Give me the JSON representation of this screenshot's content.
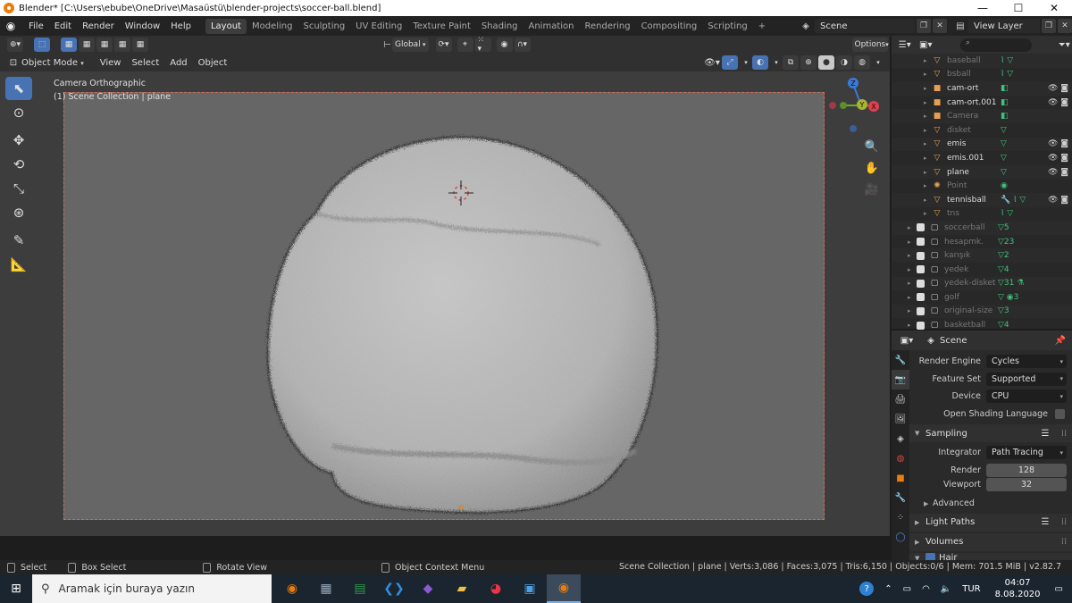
{
  "window": {
    "title": "Blender* [C:\\Users\\ebube\\OneDrive\\Masaüstü\\blender-projects\\soccer-ball.blend]",
    "min": "—",
    "max": "☐",
    "close": "✕"
  },
  "menus": [
    "File",
    "Edit",
    "Render",
    "Window",
    "Help"
  ],
  "workspaces": [
    {
      "label": "Layout",
      "active": true
    },
    {
      "label": "Modeling"
    },
    {
      "label": "Sculpting"
    },
    {
      "label": "UV Editing"
    },
    {
      "label": "Texture Paint"
    },
    {
      "label": "Shading"
    },
    {
      "label": "Animation"
    },
    {
      "label": "Rendering"
    },
    {
      "label": "Compositing"
    },
    {
      "label": "Scripting"
    }
  ],
  "add_workspace": "+",
  "scene": {
    "name": "Scene"
  },
  "view_layer": {
    "name": "View Layer"
  },
  "tool_header": {
    "orientation": "Global",
    "options": "Options"
  },
  "viewport_header": {
    "mode": "Object Mode",
    "menus": [
      "View",
      "Select",
      "Add",
      "Object"
    ]
  },
  "viewport": {
    "view_name": "Camera Orthographic",
    "collection_info": "(1) Scene Collection | plane",
    "gizmo": {
      "z": "Z",
      "y": "Y",
      "x": "X"
    }
  },
  "outliner": {
    "rows": [
      {
        "name": "baseball",
        "dim": true,
        "indent": 1,
        "icon": "▽",
        "mods": "⌇ ▽"
      },
      {
        "name": "bsball",
        "dim": true,
        "indent": 1,
        "icon": "▽",
        "mods": "⌇ ▽"
      },
      {
        "name": "cam-ort",
        "dim": false,
        "indent": 1,
        "icon": "■",
        "mods": "◧",
        "vis": "👁 ◙"
      },
      {
        "name": "cam-ort.001",
        "dim": false,
        "indent": 1,
        "icon": "■",
        "mods": "◧",
        "vis": "👁 ◙"
      },
      {
        "name": "Camera",
        "dim": true,
        "indent": 1,
        "icon": "■",
        "mods": "◧"
      },
      {
        "name": "disket",
        "dim": true,
        "indent": 1,
        "icon": "▽",
        "mods": "▽"
      },
      {
        "name": "emis",
        "dim": false,
        "indent": 1,
        "icon": "▽",
        "mods": "▽",
        "vis": "👁 ◙"
      },
      {
        "name": "emis.001",
        "dim": false,
        "indent": 1,
        "icon": "▽",
        "mods": "▽",
        "vis": "👁 ◙"
      },
      {
        "name": "plane",
        "dim": false,
        "indent": 1,
        "icon": "▽",
        "mods": "▽",
        "vis": "👁 ◙"
      },
      {
        "name": "Point",
        "dim": true,
        "indent": 1,
        "icon": "✺",
        "mods": "◉"
      },
      {
        "name": "tennisball",
        "dim": false,
        "indent": 1,
        "icon": "▽",
        "mods": "🔧 ⌇ ▽",
        "vis": "👁 ◙"
      },
      {
        "name": "tns",
        "dim": true,
        "indent": 1,
        "icon": "▽",
        "mods": "⌇ ▽"
      },
      {
        "name": "soccerball",
        "dim": true,
        "indent": 0,
        "icon": "▢",
        "mods": "▽5",
        "check": true
      },
      {
        "name": "hesapmk.",
        "dim": true,
        "indent": 0,
        "icon": "▢",
        "mods": "▽23",
        "check": true
      },
      {
        "name": "karışık",
        "dim": true,
        "indent": 0,
        "icon": "▢",
        "mods": "▽2",
        "check": true
      },
      {
        "name": "yedek",
        "dim": true,
        "indent": 0,
        "icon": "▢",
        "mods": "▽4",
        "check": true
      },
      {
        "name": "yedek-disket",
        "dim": true,
        "indent": 0,
        "icon": "▢",
        "mods": "▽31 ⚗",
        "check": true
      },
      {
        "name": "golf",
        "dim": true,
        "indent": 0,
        "icon": "▢",
        "mods": "▽ ◉3",
        "check": true
      },
      {
        "name": "original-size",
        "dim": true,
        "indent": 0,
        "icon": "▢",
        "mods": "▽3",
        "check": true
      },
      {
        "name": "basketball",
        "dim": true,
        "indent": 0,
        "icon": "▢",
        "mods": "▽4",
        "check": true
      }
    ]
  },
  "properties": {
    "header": "Scene",
    "render_engine": {
      "label": "Render Engine",
      "value": "Cycles"
    },
    "feature_set": {
      "label": "Feature Set",
      "value": "Supported"
    },
    "device": {
      "label": "Device",
      "value": "CPU"
    },
    "osl": {
      "label": "Open Shading Language"
    },
    "sampling": {
      "title": "Sampling",
      "integrator": {
        "label": "Integrator",
        "value": "Path Tracing"
      },
      "render": {
        "label": "Render",
        "value": "128"
      },
      "viewport": {
        "label": "Viewport",
        "value": "32"
      },
      "advanced": "Advanced"
    },
    "light_paths": "Light Paths",
    "volumes": "Volumes",
    "hair": "Hair"
  },
  "statusbar": {
    "select": "Select",
    "box_select": "Box Select",
    "rotate_view": "Rotate View",
    "context_menu": "Object Context Menu",
    "stats": "Scene Collection | plane | Verts:3,086 | Faces:3,075 | Tris:6,150 | Objects:0/6 | Mem: 701.5 MiB | v2.82.7"
  },
  "taskbar": {
    "search_placeholder": "Aramak için buraya yazın",
    "lang": "TUR",
    "time": "04:07",
    "date": "8.08.2020"
  },
  "colors": {
    "accent": "#4772b3",
    "frame": "#d06b5a",
    "blender_orange": "#e87d0d"
  }
}
